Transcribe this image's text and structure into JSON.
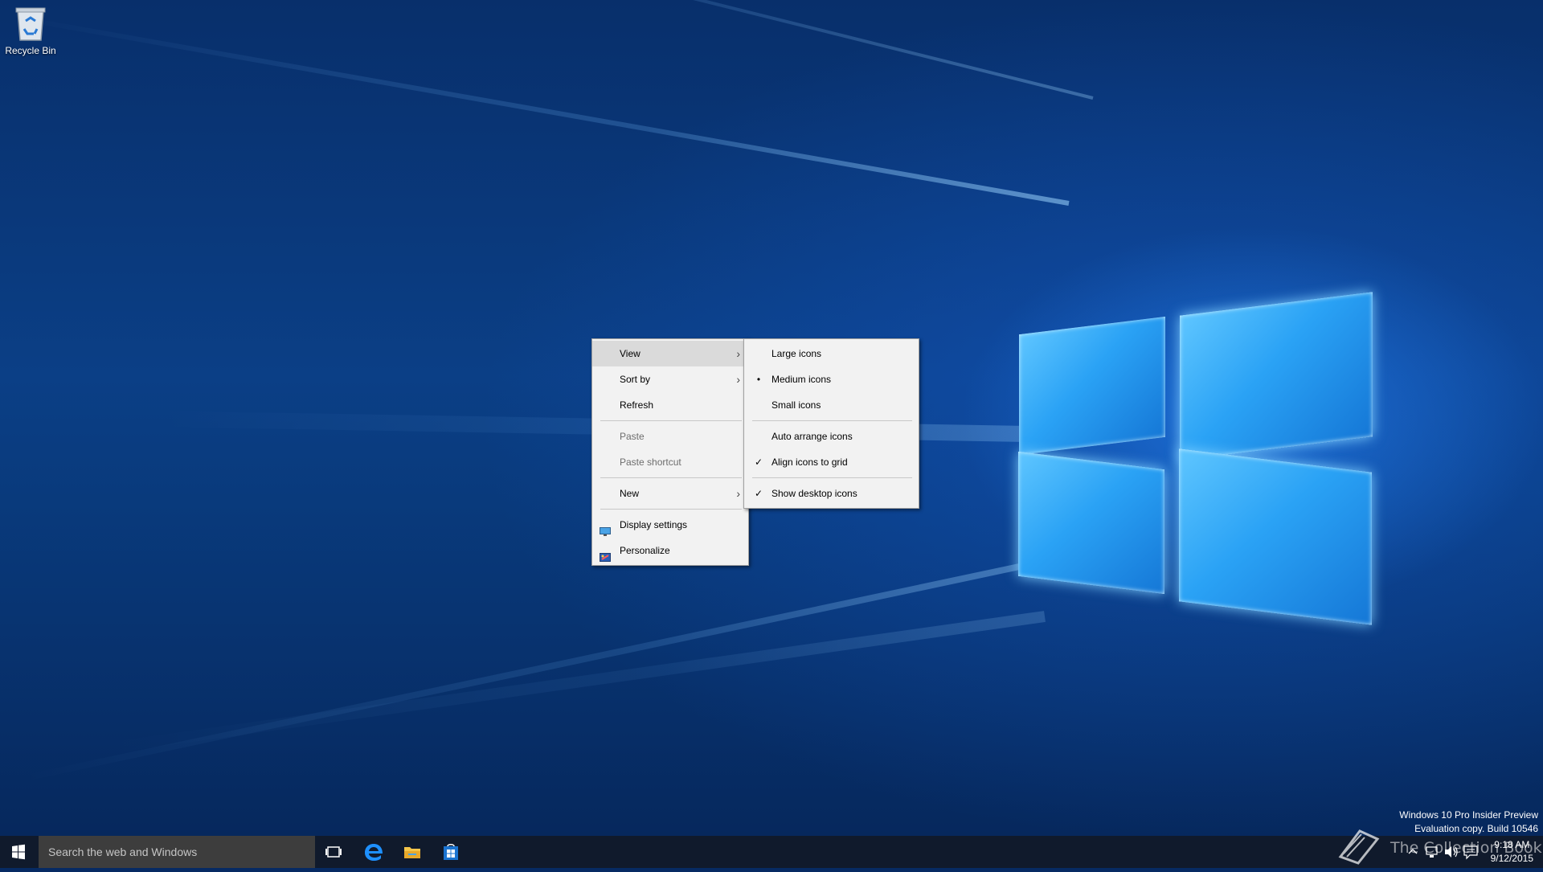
{
  "desktop": {
    "icons": [
      {
        "label": "Recycle Bin",
        "icon": "recycle-bin-icon"
      }
    ]
  },
  "context_menu": {
    "items": [
      {
        "label": "View",
        "has_submenu": true,
        "state": "highlighted"
      },
      {
        "label": "Sort by",
        "has_submenu": true
      },
      {
        "label": "Refresh"
      },
      {
        "label": "Paste",
        "disabled": true
      },
      {
        "label": "Paste shortcut",
        "disabled": true
      },
      {
        "label": "New",
        "has_submenu": true
      },
      {
        "label": "Display settings",
        "icon": "display-settings-icon"
      },
      {
        "label": "Personalize",
        "icon": "personalize-icon"
      }
    ]
  },
  "view_submenu": {
    "items": [
      {
        "label": "Large icons",
        "mark": ""
      },
      {
        "label": "Medium icons",
        "mark": "•"
      },
      {
        "label": "Small icons",
        "mark": ""
      },
      {
        "label": "Auto arrange icons",
        "mark": ""
      },
      {
        "label": "Align icons to grid",
        "mark": "✓"
      },
      {
        "label": "Show desktop icons",
        "mark": "✓"
      }
    ]
  },
  "taskbar": {
    "search_placeholder": "Search the web and Windows",
    "pinned": [
      "task-view-icon",
      "edge-icon",
      "file-explorer-icon",
      "store-icon"
    ],
    "clock": {
      "time": "9:18 AM",
      "date": "9/12/2015"
    }
  },
  "watermark": {
    "line1": "Windows 10 Pro Insider Preview",
    "line2": "Evaluation copy. Build 10546",
    "overlay_text": "The Collection Book"
  },
  "colors": {
    "menu_bg": "#f2f2f2",
    "menu_highlight": "#dadada",
    "taskbar_bg": "#101a2c",
    "search_bg": "#3d3d3d",
    "accent": "#1e90ff"
  }
}
